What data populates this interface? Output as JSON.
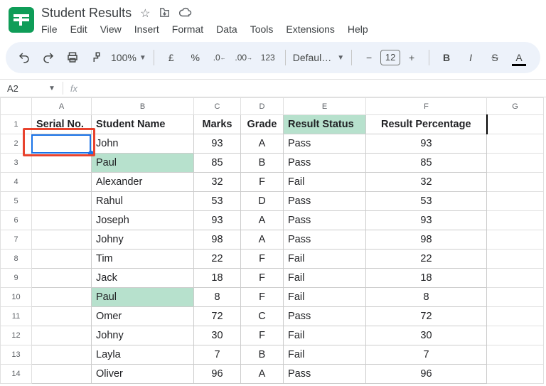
{
  "doc": {
    "title": "Student Results"
  },
  "menus": [
    "File",
    "Edit",
    "View",
    "Insert",
    "Format",
    "Data",
    "Tools",
    "Extensions",
    "Help"
  ],
  "toolbar": {
    "zoom": "100%",
    "currency": "£",
    "percent": "%",
    "numfmt": "123",
    "font": "Defaul…",
    "fontsize": "12"
  },
  "namebox": "A2",
  "fxlabel": "fx",
  "columns": [
    "A",
    "B",
    "C",
    "D",
    "E",
    "F",
    "G"
  ],
  "headers": {
    "A": "Serial No.",
    "B": "Student  Name",
    "C": "Marks",
    "D": "Grade",
    "E": "Result Status",
    "F": "Result Percentage"
  },
  "rows": [
    {
      "n": "2",
      "a": "",
      "b": "John",
      "c": "93",
      "d": "A",
      "e": "Pass",
      "f": "93",
      "hi": false
    },
    {
      "n": "3",
      "a": "",
      "b": "Paul",
      "c": "85",
      "d": "B",
      "e": "Pass",
      "f": "85",
      "hi": true
    },
    {
      "n": "4",
      "a": "",
      "b": "Alexander",
      "c": "32",
      "d": "F",
      "e": "Fail",
      "f": "32",
      "hi": false
    },
    {
      "n": "5",
      "a": "",
      "b": "Rahul",
      "c": "53",
      "d": "D",
      "e": "Pass",
      "f": "53",
      "hi": false
    },
    {
      "n": "6",
      "a": "",
      "b": "Joseph",
      "c": "93",
      "d": "A",
      "e": "Pass",
      "f": "93",
      "hi": false
    },
    {
      "n": "7",
      "a": "",
      "b": "Johny",
      "c": "98",
      "d": "A",
      "e": "Pass",
      "f": "98",
      "hi": false
    },
    {
      "n": "8",
      "a": "",
      "b": "Tim",
      "c": "22",
      "d": "F",
      "e": "Fail",
      "f": "22",
      "hi": false
    },
    {
      "n": "9",
      "a": "",
      "b": "Jack",
      "c": "18",
      "d": "F",
      "e": "Fail",
      "f": "18",
      "hi": false
    },
    {
      "n": "10",
      "a": "",
      "b": "Paul",
      "c": "8",
      "d": "F",
      "e": "Fail",
      "f": "8",
      "hi": true
    },
    {
      "n": "11",
      "a": "",
      "b": "Omer",
      "c": "72",
      "d": "C",
      "e": "Pass",
      "f": "72",
      "hi": false
    },
    {
      "n": "12",
      "a": "",
      "b": "Johny",
      "c": "30",
      "d": "F",
      "e": "Fail",
      "f": "30",
      "hi": false
    },
    {
      "n": "13",
      "a": "",
      "b": "Layla",
      "c": "7",
      "d": "B",
      "e": "Fail",
      "f": "7",
      "hi": false
    },
    {
      "n": "14",
      "a": "",
      "b": "Oliver",
      "c": "96",
      "d": "A",
      "e": "Pass",
      "f": "96",
      "hi": false
    }
  ]
}
